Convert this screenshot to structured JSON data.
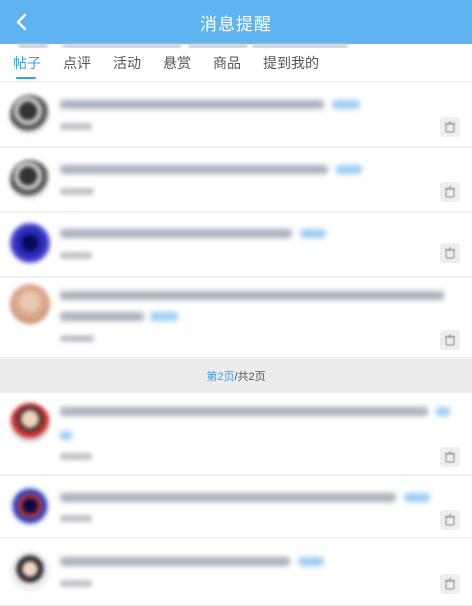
{
  "header": {
    "title": "消息提醒",
    "back_icon": "chevron-left-icon"
  },
  "tabs": [
    {
      "label": "帖子",
      "active": true
    },
    {
      "label": "点评",
      "active": false
    },
    {
      "label": "活动",
      "active": false
    },
    {
      "label": "悬赏",
      "active": false
    },
    {
      "label": "商品",
      "active": false
    },
    {
      "label": "提到我的",
      "active": false
    }
  ],
  "pager": {
    "current": "第2页",
    "total": "/共2页"
  },
  "colors": {
    "header_bg": "#5fb3f0",
    "accent": "#3b9de6"
  },
  "icons": {
    "delete": "trash-icon"
  }
}
